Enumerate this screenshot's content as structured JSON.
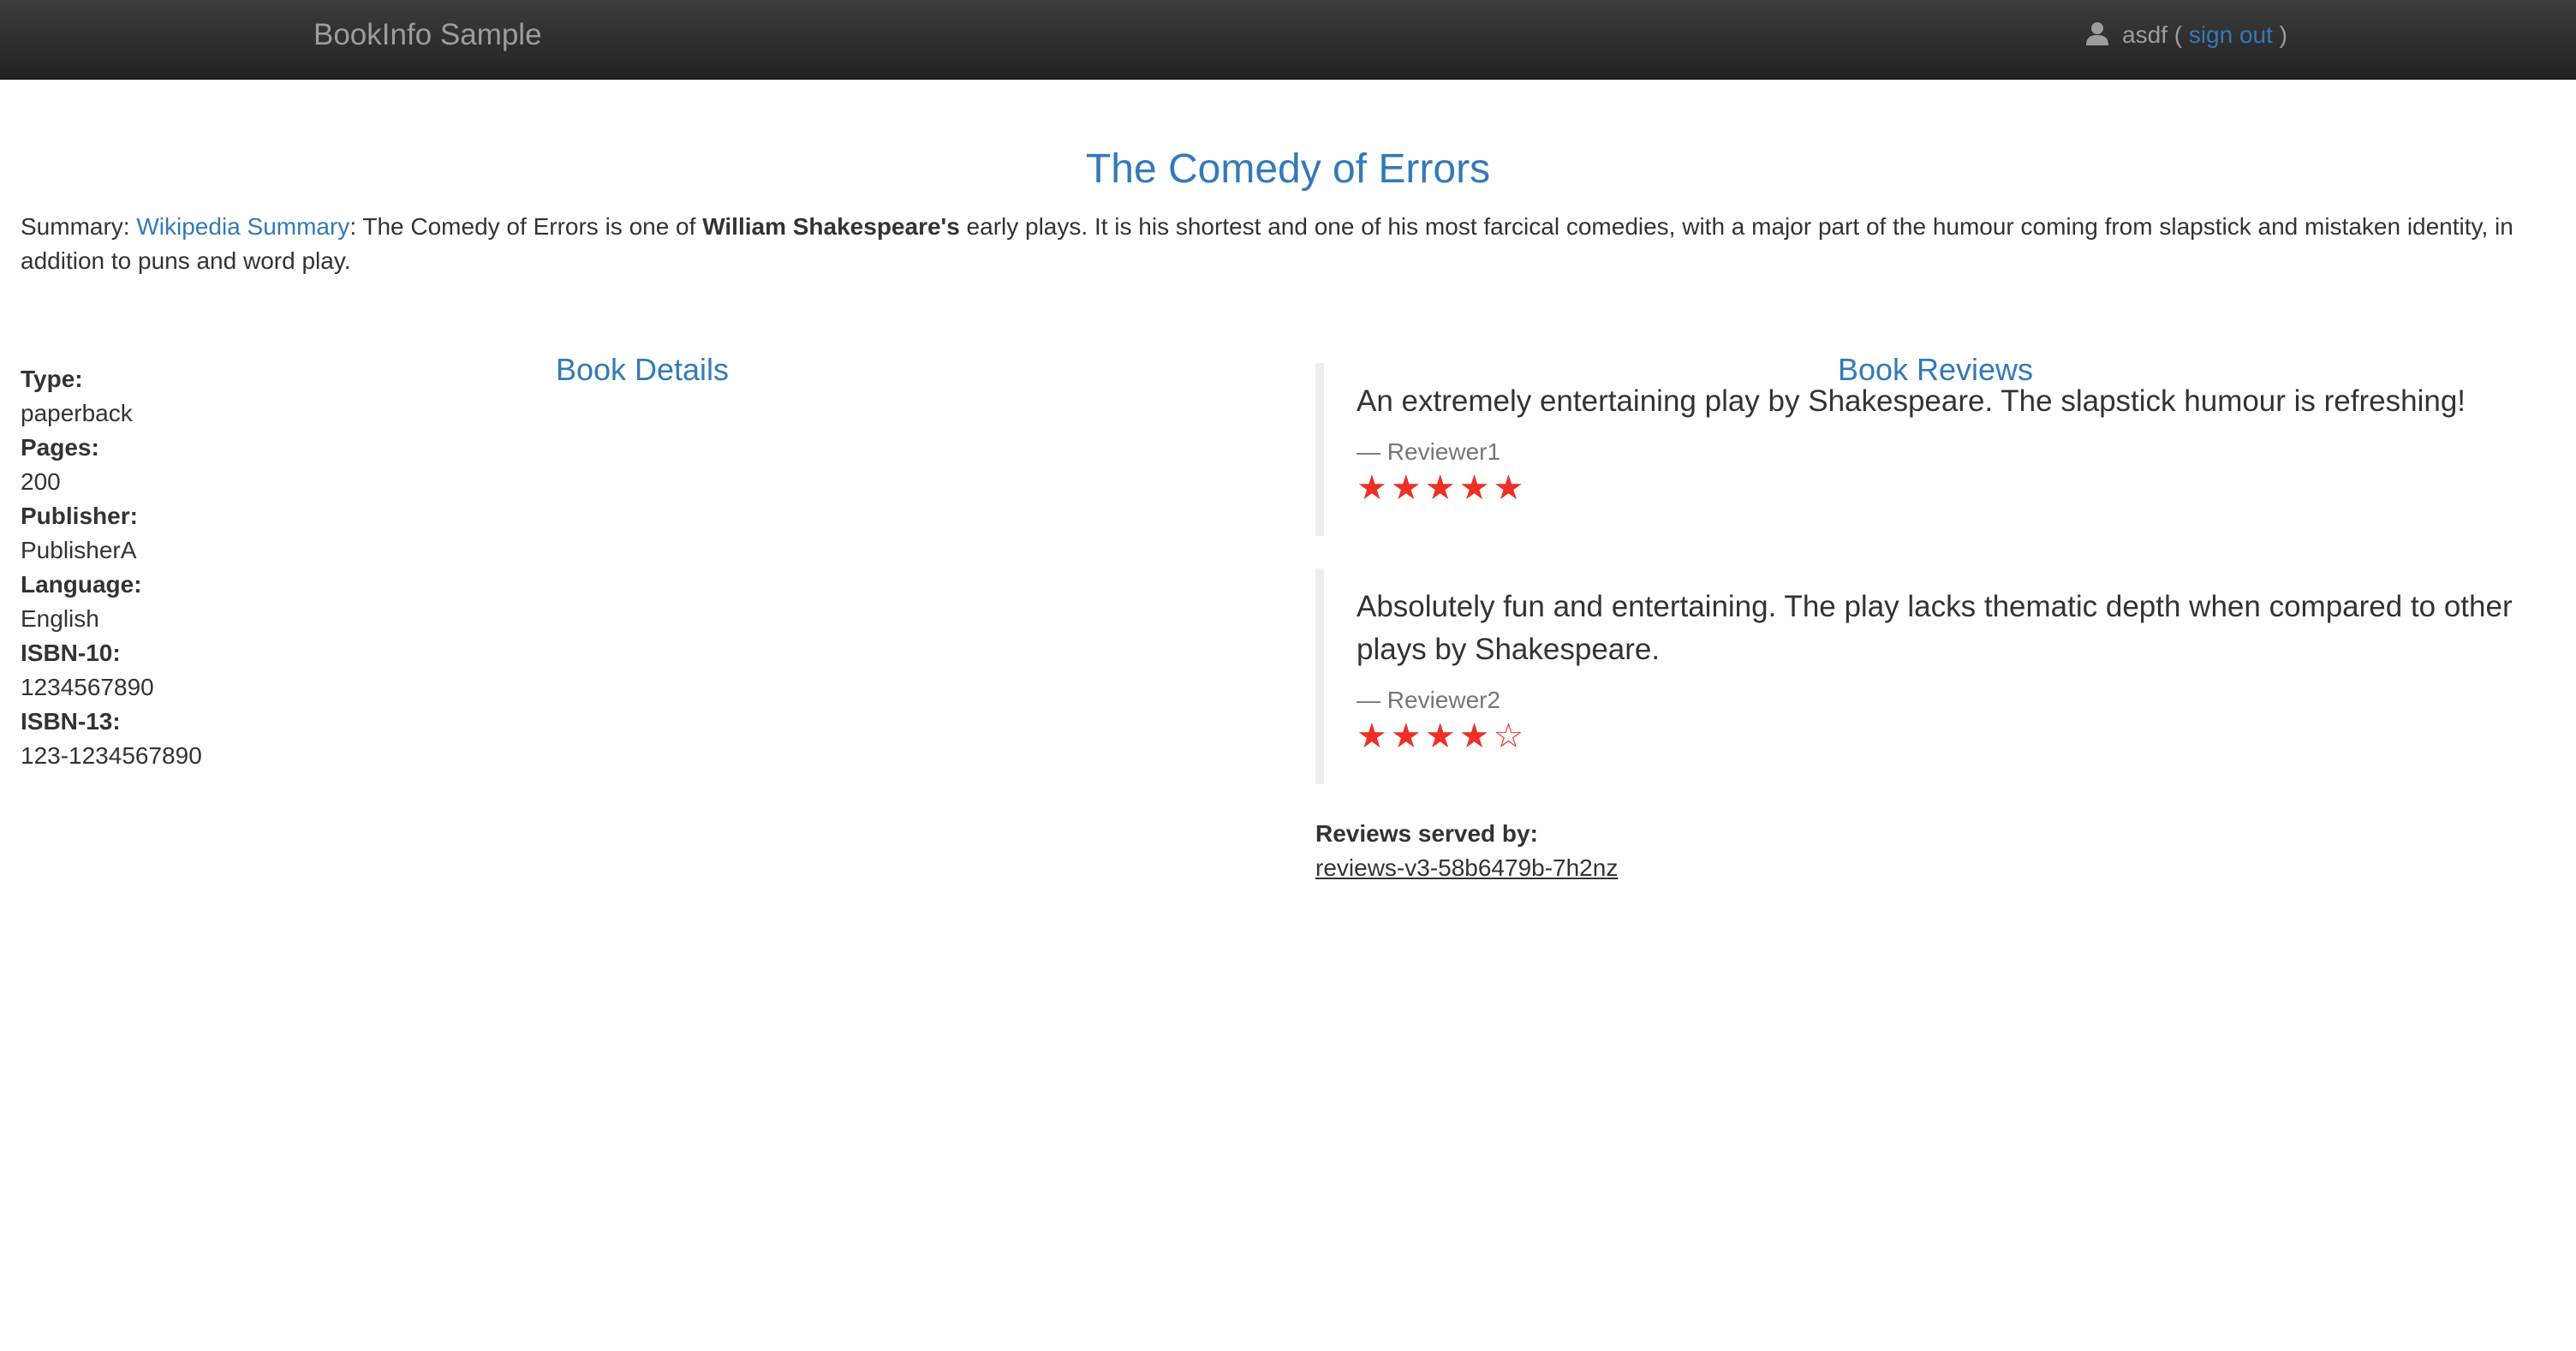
{
  "nav": {
    "brand": "BookInfo Sample",
    "user": "asdf",
    "open_paren": " ( ",
    "signout": "sign out",
    "close_paren": " )"
  },
  "book": {
    "title": "The Comedy of Errors",
    "summary_prefix": "Summary: ",
    "summary_link": "Wikipedia Summary",
    "summary_text_1": ": The Comedy of Errors is one of ",
    "summary_bold": "William Shakespeare's",
    "summary_text_2": " early plays. It is his shortest and one of his most farcical comedies, with a major part of the humour coming from slapstick and mistaken identity, in addition to puns and word play."
  },
  "details": {
    "heading": "Book Details",
    "items": [
      {
        "label": "Type:",
        "value": "paperback"
      },
      {
        "label": "Pages:",
        "value": "200"
      },
      {
        "label": "Publisher:",
        "value": "PublisherA"
      },
      {
        "label": "Language:",
        "value": "English"
      },
      {
        "label": "ISBN-10:",
        "value": "1234567890"
      },
      {
        "label": "ISBN-13:",
        "value": "123-1234567890"
      }
    ]
  },
  "reviews": {
    "heading": "Book Reviews",
    "items": [
      {
        "text": "An extremely entertaining play by Shakespeare. The slapstick humour is refreshing!",
        "reviewer": "— Reviewer1",
        "rating": 5,
        "max": 5
      },
      {
        "text": "Absolutely fun and entertaining. The play lacks thematic depth when compared to other plays by Shakespeare.",
        "reviewer": "— Reviewer2",
        "rating": 4,
        "max": 5
      }
    ],
    "served_label": "Reviews served by:",
    "served_pod": "reviews-v3-58b6479b-7h2nz"
  },
  "colors": {
    "accent": "#337ab7",
    "star": "#ed2f26",
    "navbar": "#222222"
  },
  "icons": {
    "user": "user-icon",
    "star_filled": "star-filled-icon",
    "star_empty": "star-empty-icon"
  }
}
